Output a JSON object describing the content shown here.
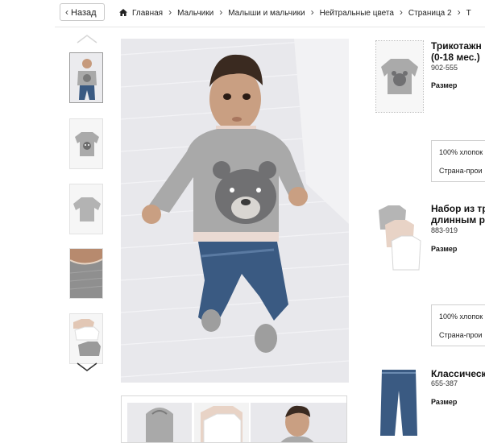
{
  "nav": {
    "back_label": "Назад",
    "breadcrumbs": [
      "Главная",
      "Мальчики",
      "Малыши и мальчики",
      "Нейтральные цвета",
      "Страница 2",
      "Т"
    ]
  },
  "products": [
    {
      "title_line1": "Трикотажн",
      "title_line2": "(0-18 мес.)",
      "code": "902-555",
      "size_label": "Размер",
      "material": "100% хлопок",
      "country_label": "Страна-прои"
    },
    {
      "title_line1": "Набор из тр",
      "title_line2": "длинным р",
      "code": "883-919",
      "size_label": "Размер",
      "material": "100% хлопок",
      "country_label": "Страна-прои"
    },
    {
      "title_line1": "Классическ",
      "code": "655-387",
      "size_label": "Размер"
    }
  ],
  "colors": {
    "sweater": "#a9a9a9",
    "jeans": "#3a5a82",
    "blanket": "#e9e9ec"
  }
}
